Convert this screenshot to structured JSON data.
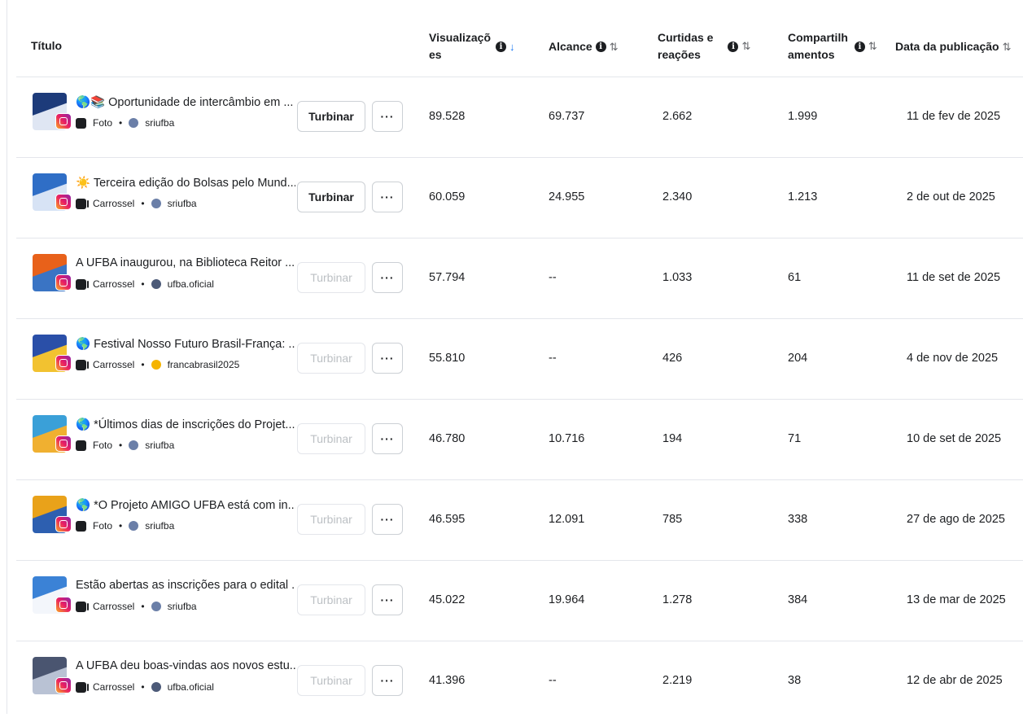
{
  "header": {
    "title": "Título",
    "views": "Visualizações",
    "views_l1": "Visualizaçõ",
    "views_l2": "es",
    "reach": "Alcance",
    "reactions_l1": "Curtidas e",
    "reactions_l2": "reações",
    "shares_l1": "Compartilh",
    "shares_l2": "amentos",
    "date": "Data da publicação"
  },
  "buttons": {
    "boost": "Turbinar",
    "more": "···"
  },
  "colors": {
    "accent": "#1877f2",
    "border": "#e4e6eb",
    "text": "#1c1e21",
    "disabled": "#bcc0c4"
  },
  "rows": [
    {
      "emoji": "🌎📚",
      "title": "Oportunidade de intercâmbio em ...",
      "type": "Foto",
      "type_icon": "photo-icon",
      "account": "sriufba",
      "boost_enabled": true,
      "views": "89.528",
      "reach": "69.737",
      "reactions": "2.662",
      "shares": "1.999",
      "date": "11 de fev de 2025"
    },
    {
      "emoji": "☀️",
      "title": "Terceira edição do Bolsas pelo Mund...",
      "type": "Carrossel",
      "type_icon": "carousel-icon",
      "account": "sriufba",
      "boost_enabled": true,
      "views": "60.059",
      "reach": "24.955",
      "reactions": "2.340",
      "shares": "1.213",
      "date": "2 de out de 2025"
    },
    {
      "emoji": "",
      "title": "A UFBA inaugurou, na Biblioteca Reitor ...",
      "type": "Carrossel",
      "type_icon": "carousel-icon",
      "account": "ufba.oficial",
      "boost_enabled": false,
      "views": "57.794",
      "reach": "--",
      "reactions": "1.033",
      "shares": "61",
      "date": "11 de set de 2025"
    },
    {
      "emoji": "🌎",
      "title": "Festival Nosso Futuro Brasil-França: ...",
      "type": "Carrossel",
      "type_icon": "carousel-icon",
      "account": "francabrasil2025",
      "boost_enabled": false,
      "views": "55.810",
      "reach": "--",
      "reactions": "426",
      "shares": "204",
      "date": "4 de nov de 2025"
    },
    {
      "emoji": "🌎",
      "title": "*Últimos dias de inscrições do Projet...",
      "type": "Foto",
      "type_icon": "photo-icon",
      "account": "sriufba",
      "boost_enabled": false,
      "views": "46.780",
      "reach": "10.716",
      "reactions": "194",
      "shares": "71",
      "date": "10 de set de 2025"
    },
    {
      "emoji": "🌎",
      "title": "*O Projeto AMIGO UFBA está com in...",
      "type": "Foto",
      "type_icon": "photo-icon",
      "account": "sriufba",
      "boost_enabled": false,
      "views": "46.595",
      "reach": "12.091",
      "reactions": "785",
      "shares": "338",
      "date": "27 de ago de 2025"
    },
    {
      "emoji": "",
      "title": "Estão abertas as inscrições para o edital ...",
      "type": "Carrossel",
      "type_icon": "carousel-icon",
      "account": "sriufba",
      "boost_enabled": false,
      "views": "45.022",
      "reach": "19.964",
      "reactions": "1.278",
      "shares": "384",
      "date": "13 de mar de 2025"
    },
    {
      "emoji": "",
      "title": "A UFBA deu boas-vindas aos novos estu...",
      "type": "Carrossel",
      "type_icon": "carousel-icon",
      "account": "ufba.oficial",
      "boost_enabled": false,
      "views": "41.396",
      "reach": "--",
      "reactions": "2.219",
      "shares": "38",
      "date": "12 de abr de 2025"
    }
  ]
}
